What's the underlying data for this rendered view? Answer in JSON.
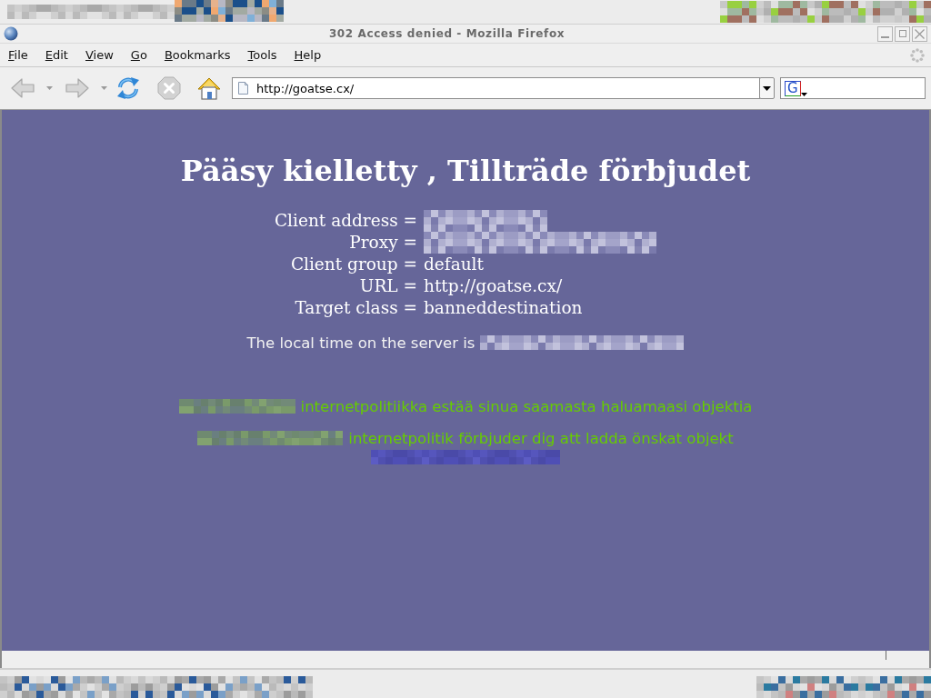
{
  "desktop_panel": {
    "redacted": true
  },
  "window": {
    "title": "302 Access denied - Mozilla Firefox"
  },
  "menu_bar": [
    "File",
    "Edit",
    "View",
    "Go",
    "Bookmarks",
    "Tools",
    "Help"
  ],
  "toolbar": {
    "buttons": [
      {
        "kind": "back",
        "disabled": true
      },
      {
        "kind": "forward",
        "disabled": true
      },
      {
        "kind": "reload",
        "disabled": false
      },
      {
        "kind": "stop",
        "disabled": true
      },
      {
        "kind": "home",
        "disabled": false
      }
    ],
    "address": {
      "value": "http://goatse.cx/"
    },
    "search": {
      "engine_badge": "G"
    }
  },
  "page": {
    "heading": "Pääsy kielletty , Tillträde förbjudet",
    "fields": [
      {
        "label": "Client address =",
        "kind": "redacted"
      },
      {
        "label": "Proxy =",
        "kind": "redacted"
      },
      {
        "label": "Client group =",
        "kind": "text",
        "value": "default"
      },
      {
        "label": "URL =",
        "kind": "text",
        "value": "http://goatse.cx/"
      },
      {
        "label": "Target class =",
        "kind": "text",
        "value": "banneddestination"
      }
    ],
    "local_time": {
      "label": "The local time on the server is",
      "kind": "redacted"
    },
    "messages": [
      {
        "kind": "redacted",
        "text": "internetpolitiikka estää sinua saamasta haluamaasi objektia"
      },
      {
        "kind": "redacted",
        "text": "internetpolitik förbjuder dig att ladda önskat objekt"
      }
    ],
    "link": {
      "kind": "redacted"
    }
  },
  "taskbar": {
    "redacted": true
  }
}
